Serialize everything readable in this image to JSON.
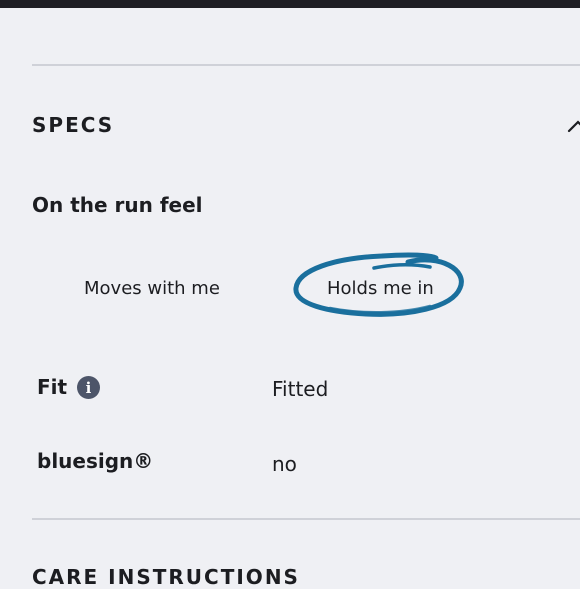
{
  "specs": {
    "title": "SPECS",
    "collapse_icon": "chevron-up-icon",
    "run_feel": {
      "heading": "On the run feel",
      "options": [
        {
          "label": "Moves with me",
          "selected": false
        },
        {
          "label": "Holds me in",
          "selected": true
        }
      ],
      "highlight_color": "#1a6f9d"
    },
    "rows": [
      {
        "label": "Fit",
        "icon": "info-icon",
        "icon_glyph": "i",
        "value": "Fitted"
      },
      {
        "label": "bluesign®",
        "value": "no"
      }
    ]
  },
  "care": {
    "title": "CARE INSTRUCTIONS"
  }
}
